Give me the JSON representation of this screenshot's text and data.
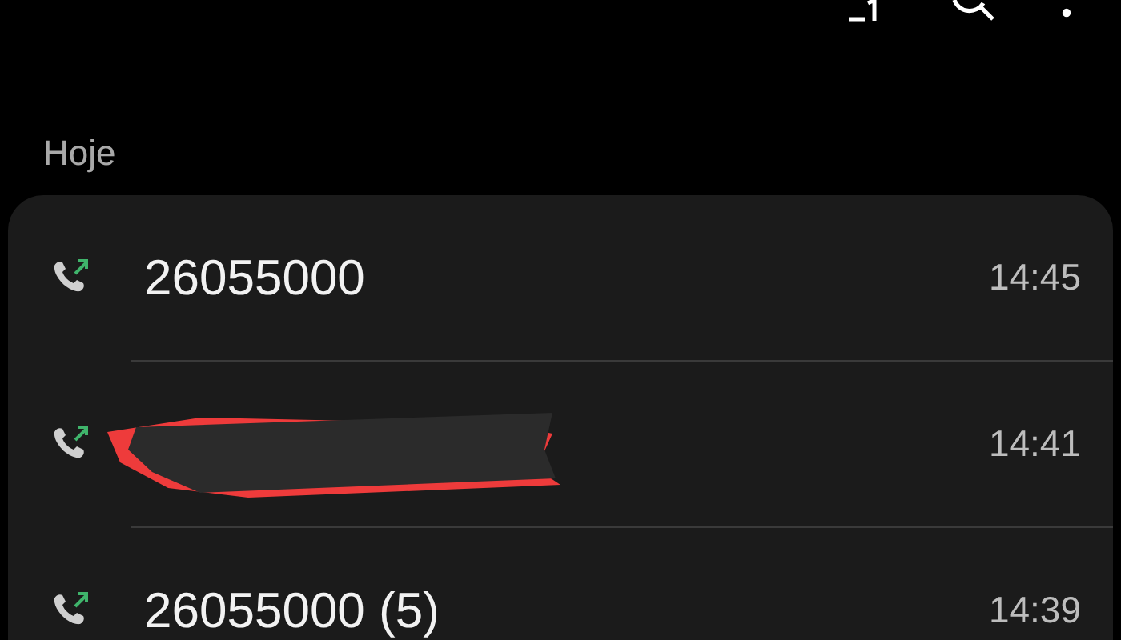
{
  "section": {
    "title": "Hoje"
  },
  "calls": [
    {
      "kind": "number",
      "number": "26055000",
      "time": "14:45"
    },
    {
      "kind": "redacted",
      "time": "14:41"
    },
    {
      "kind": "number",
      "number": "26055000 (5)",
      "time": "14:39"
    }
  ]
}
